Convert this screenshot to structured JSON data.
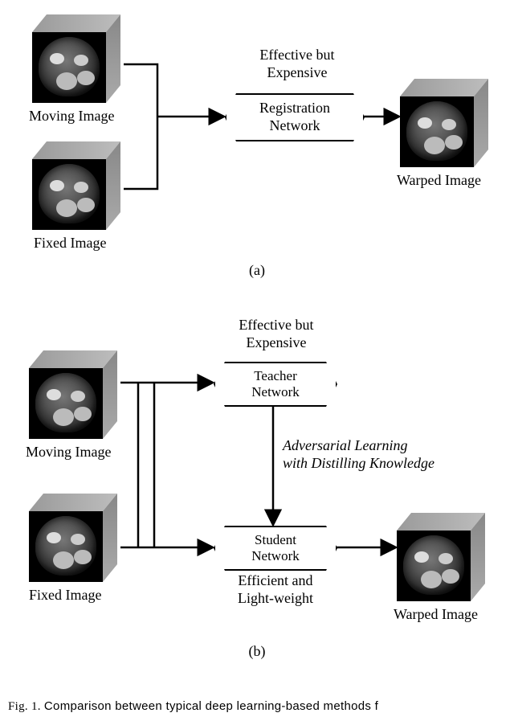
{
  "figA": {
    "moving_label": "Moving Image",
    "fixed_label": "Fixed Image",
    "warped_label": "Warped Image",
    "annot": "Effective but\nExpensive",
    "box": "Registration\nNetwork",
    "sub": "(a)"
  },
  "figB": {
    "moving_label": "Moving Image",
    "fixed_label": "Fixed Image",
    "warped_label": "Warped Image",
    "annot_top": "Effective but\nExpensive",
    "annot_bottom": "Efficient and\nLight-weight",
    "annot_mid": "Adversarial Learning\nwith Distilling Knowledge",
    "box_teacher": "Teacher\nNetwork",
    "box_student": "Student\nNetwork",
    "sub": "(b)"
  },
  "caption_fragment": "Comparison between typical deep learning-based methods f"
}
